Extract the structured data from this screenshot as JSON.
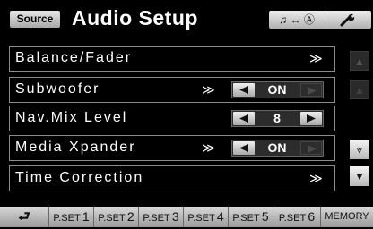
{
  "header": {
    "source_label": "Source",
    "title": "Audio Setup",
    "sound_mode_icon": "♫ ↔ Ⓐ",
    "wrench_icon": "wrench-icon"
  },
  "rows": [
    {
      "label": "Balance/Fader",
      "arrow": "≫"
    },
    {
      "label": "Subwoofer",
      "arrow": "≫",
      "value": "ON"
    },
    {
      "label": "Nav.Mix Level",
      "value": "8"
    },
    {
      "label": "Media Xpander",
      "arrow": "≫",
      "value": "ON"
    },
    {
      "label": "Time Correction",
      "arrow": "≫"
    }
  ],
  "side_buttons": [
    "▲",
    "⩓",
    "⩔",
    "▼"
  ],
  "presets": {
    "back_glyph": "⮐",
    "items": [
      {
        "prefix": "P.SET",
        "num": "1"
      },
      {
        "prefix": "P.SET",
        "num": "2"
      },
      {
        "prefix": "P.SET",
        "num": "3"
      },
      {
        "prefix": "P.SET",
        "num": "4"
      },
      {
        "prefix": "P.SET",
        "num": "5"
      },
      {
        "prefix": "P.SET",
        "num": "6"
      }
    ],
    "memory_label": "MEMORY"
  }
}
